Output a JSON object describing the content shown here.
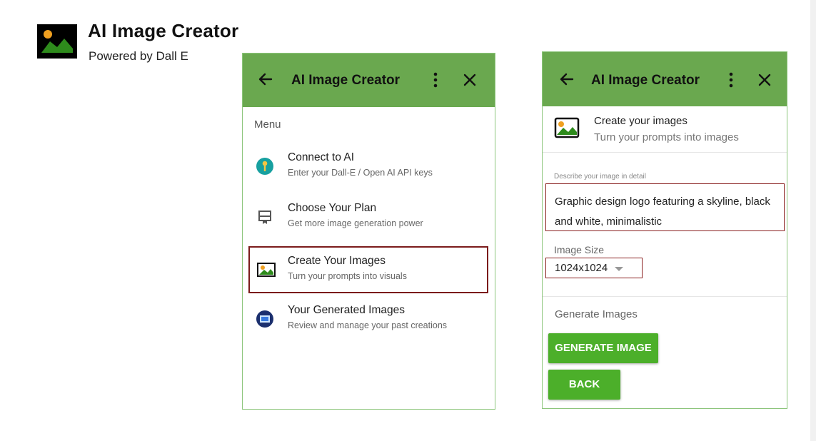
{
  "app": {
    "title": "AI Image Creator",
    "subtitle": "Powered by Dall E",
    "logo_icon": "landscape-image-icon"
  },
  "colors": {
    "header_green": "#6aa84f",
    "button_green": "#4caf2a",
    "highlight_border": "#7b1b1b",
    "panel_border": "#8cc57b"
  },
  "menu_panel": {
    "header": {
      "title": "AI Image Creator",
      "back_icon": "arrow-left-icon",
      "more_icon": "more-vertical-icon",
      "close_icon": "close-icon"
    },
    "menu_label": "Menu",
    "items": [
      {
        "label": "Connect to AI",
        "sub": "Enter your Dall-E / Open AI API keys",
        "icon": "key-icon"
      },
      {
        "label": "Choose Your Plan",
        "sub": "Get more image generation power",
        "icon": "plan-card-icon"
      },
      {
        "label": "Create Your Images",
        "sub": "Turn your prompts into visuals",
        "icon": "landscape-image-icon",
        "selected": true
      },
      {
        "label": "Your Generated Images",
        "sub": "Review and manage your past creations",
        "icon": "gallery-icon"
      }
    ]
  },
  "create_panel": {
    "header": {
      "title": "AI Image Creator",
      "back_icon": "arrow-left-icon",
      "more_icon": "more-vertical-icon",
      "close_icon": "close-icon"
    },
    "section_title": "Create your images",
    "section_sub": "Turn your prompts into images",
    "section_icon": "landscape-image-icon",
    "description_label": "Describe your image in detail",
    "description_value": "Graphic design logo featuring a skyline, black and white, minimalistic",
    "image_size_label": "Image Size",
    "image_size_value": "1024x1024",
    "generate_label": "Generate Images",
    "generate_button": "GENERATE IMAGE",
    "back_button": "BACK"
  }
}
